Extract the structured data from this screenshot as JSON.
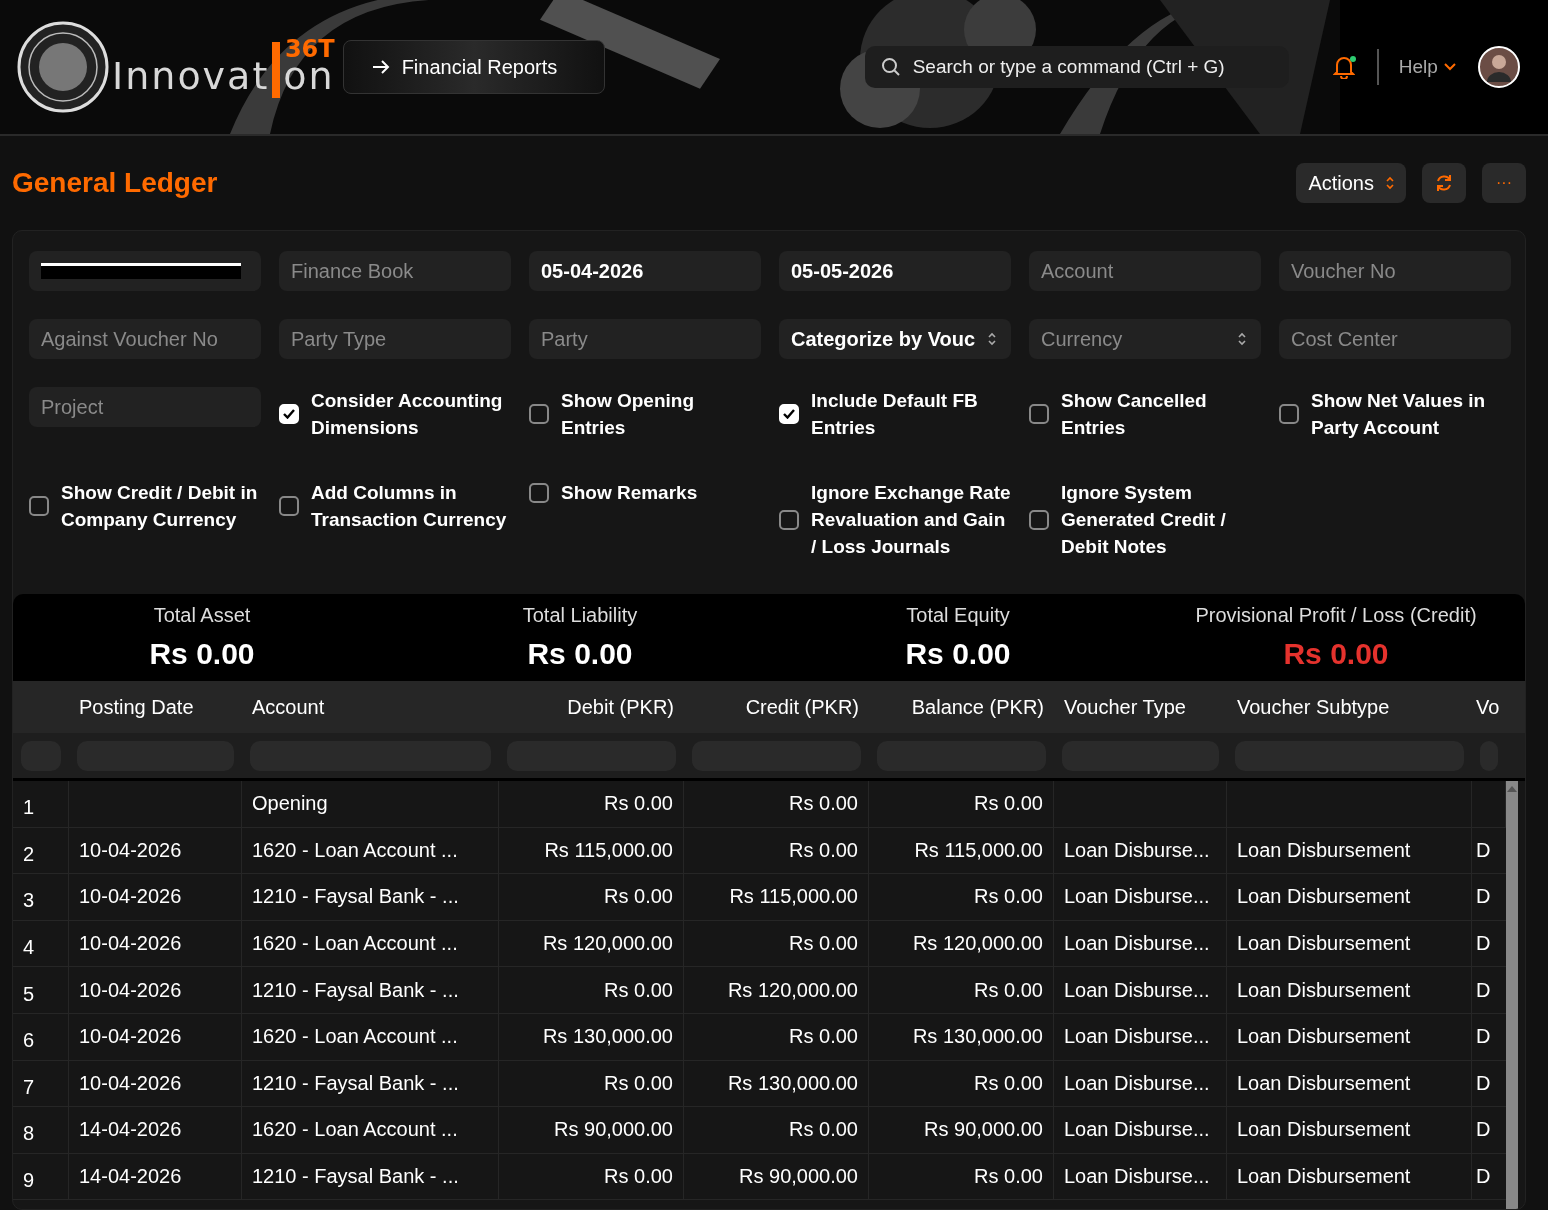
{
  "header": {
    "logo_text": "Innovat",
    "logo_text_end": "on",
    "logo_badge": "36T",
    "breadcrumb": "Financial Reports",
    "search": {
      "placeholder": "Search or type a command (Ctrl + G)"
    },
    "notification_dot": true,
    "help": "Help"
  },
  "page": {
    "title": "General Ledger",
    "actions": "Actions",
    "more": "···"
  },
  "filters": [
    {
      "kind": "redacted"
    },
    {
      "kind": "field",
      "placeholder": "Finance Book"
    },
    {
      "kind": "field",
      "value": "05-04-2026"
    },
    {
      "kind": "field",
      "value": "05-05-2026"
    },
    {
      "kind": "field",
      "placeholder": "Account"
    },
    {
      "kind": "field",
      "placeholder": "Voucher No"
    },
    {
      "kind": "field",
      "placeholder": "Against Voucher No"
    },
    {
      "kind": "field",
      "placeholder": "Party Type"
    },
    {
      "kind": "field",
      "placeholder": "Party"
    },
    {
      "kind": "select",
      "value": "Categorize by Vouc"
    },
    {
      "kind": "select",
      "placeholder": "Currency"
    },
    {
      "kind": "field",
      "placeholder": "Cost Center"
    },
    {
      "kind": "field",
      "placeholder": "Project"
    },
    {
      "kind": "checkbox",
      "label": "Consider Accounting Dimensions",
      "checked": true
    },
    {
      "kind": "checkbox",
      "label": "Show Opening Entries",
      "checked": false
    },
    {
      "kind": "checkbox",
      "label": "Include Default FB Entries",
      "checked": true
    },
    {
      "kind": "checkbox",
      "label": "Show Cancelled Entries",
      "checked": false
    },
    {
      "kind": "checkbox",
      "label": "Show Net Values in Party Account",
      "checked": false
    },
    {
      "kind": "checkbox",
      "label": "Show Credit / Debit in Company Currency",
      "checked": false
    },
    {
      "kind": "checkbox",
      "label": "Add Columns in Transaction Currency",
      "checked": false
    },
    {
      "kind": "checkbox",
      "label": "Show Remarks",
      "checked": false
    },
    {
      "kind": "checkbox",
      "label": "Ignore Exchange Rate Revaluation and Gain / Loss Journals",
      "checked": false
    },
    {
      "kind": "checkbox",
      "label": "Ignore System Generated Credit / Debit Notes",
      "checked": false
    }
  ],
  "summary": [
    {
      "label": "Total Asset",
      "value": "Rs 0.00",
      "color": "#ffffff"
    },
    {
      "label": "Total Liability",
      "value": "Rs 0.00",
      "color": "#ffffff"
    },
    {
      "label": "Total Equity",
      "value": "Rs 0.00",
      "color": "#ffffff"
    },
    {
      "label": "Provisional Profit / Loss (Credit)",
      "value": "Rs 0.00",
      "color": "#e5322d"
    }
  ],
  "table": {
    "columns": [
      {
        "label": "Posting Date",
        "kind": "text"
      },
      {
        "label": "Account",
        "kind": "text"
      },
      {
        "label": "Debit (PKR)",
        "kind": "amount"
      },
      {
        "label": "Credit (PKR)",
        "kind": "amount"
      },
      {
        "label": "Balance (PKR)",
        "kind": "amount"
      },
      {
        "label": "Voucher Type",
        "kind": "text"
      },
      {
        "label": "Voucher Subtype",
        "kind": "text"
      },
      {
        "label": "Vo",
        "kind": "text"
      }
    ],
    "rows": [
      {
        "index": "1",
        "cells": [
          "",
          "Opening",
          "Rs 0.00",
          "Rs 0.00",
          "Rs 0.00",
          "",
          "",
          ""
        ]
      },
      {
        "index": "2",
        "cells": [
          "10-04-2026",
          "1620 - Loan Account ...",
          "Rs 115,000.00",
          "Rs 0.00",
          "Rs 115,000.00",
          "Loan Disburse...",
          "Loan Disbursement",
          "D"
        ]
      },
      {
        "index": "3",
        "cells": [
          "10-04-2026",
          "1210 - Faysal Bank - ...",
          "Rs 0.00",
          "Rs 115,000.00",
          "Rs 0.00",
          "Loan Disburse...",
          "Loan Disbursement",
          "D"
        ]
      },
      {
        "index": "4",
        "cells": [
          "10-04-2026",
          "1620 - Loan Account ...",
          "Rs 120,000.00",
          "Rs 0.00",
          "Rs 120,000.00",
          "Loan Disburse...",
          "Loan Disbursement",
          "D"
        ]
      },
      {
        "index": "5",
        "cells": [
          "10-04-2026",
          "1210 - Faysal Bank - ...",
          "Rs 0.00",
          "Rs 120,000.00",
          "Rs 0.00",
          "Loan Disburse...",
          "Loan Disbursement",
          "D"
        ]
      },
      {
        "index": "6",
        "cells": [
          "10-04-2026",
          "1620 - Loan Account ...",
          "Rs 130,000.00",
          "Rs 0.00",
          "Rs 130,000.00",
          "Loan Disburse...",
          "Loan Disbursement",
          "D"
        ]
      },
      {
        "index": "7",
        "cells": [
          "10-04-2026",
          "1210 - Faysal Bank - ...",
          "Rs 0.00",
          "Rs 130,000.00",
          "Rs 0.00",
          "Loan Disburse...",
          "Loan Disbursement",
          "D"
        ]
      },
      {
        "index": "8",
        "cells": [
          "14-04-2026",
          "1620 - Loan Account ...",
          "Rs 90,000.00",
          "Rs 0.00",
          "Rs 90,000.00",
          "Loan Disburse...",
          "Loan Disbursement",
          "D"
        ]
      },
      {
        "index": "9",
        "cells": [
          "14-04-2026",
          "1210 - Faysal Bank - ...",
          "Rs 0.00",
          "Rs 90,000.00",
          "Rs 0.00",
          "Loan Disburse...",
          "Loan Disbursement",
          "D"
        ]
      }
    ]
  }
}
